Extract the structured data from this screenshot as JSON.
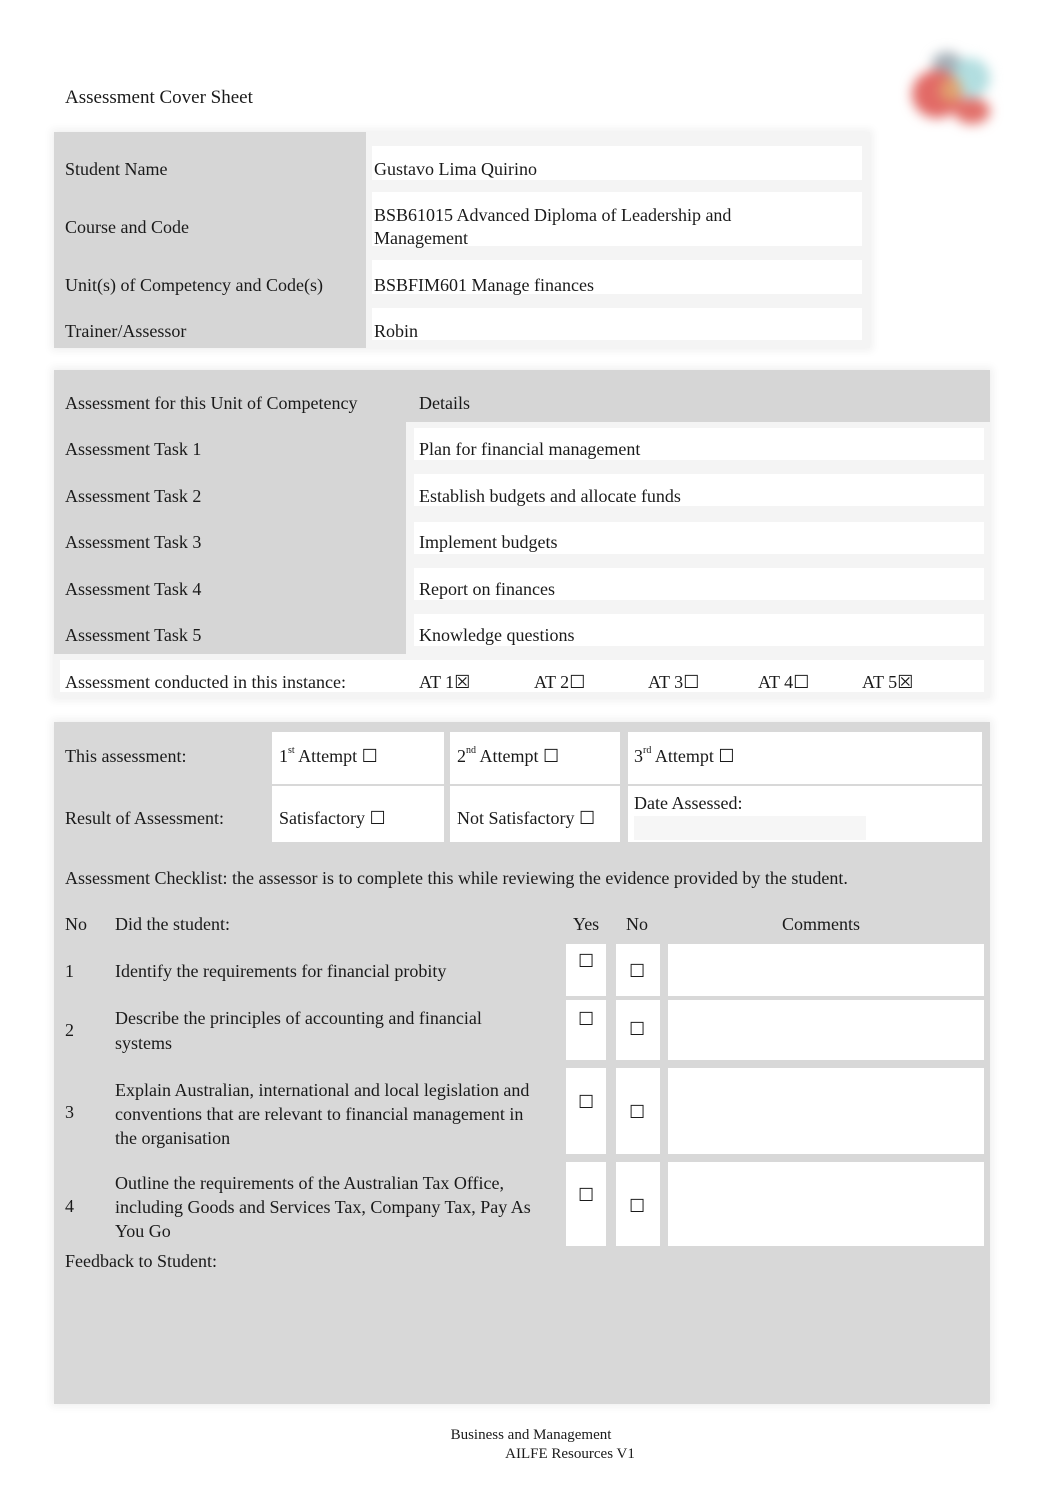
{
  "header": {
    "title": "Assessment Cover Sheet",
    "logo": "institution-logo"
  },
  "details": [
    {
      "label": "Student Name",
      "value": "Gustavo Lima Quirino"
    },
    {
      "label": "Course and Code",
      "value": "BSB61015 Advanced Diploma of Leadership and Management"
    },
    {
      "label": "Unit(s) of Competency and Code(s)",
      "value": "BSBFIM601 Manage finances"
    },
    {
      "label": "Trainer/Assessor",
      "value": "Robin"
    }
  ],
  "tasks": {
    "header_left": "Assessment for this Unit of Competency",
    "header_right": "Details",
    "rows": [
      {
        "label": "Assessment Task 1",
        "value": "Plan for financial management"
      },
      {
        "label": "Assessment Task 2",
        "value": "Establish budgets and allocate funds"
      },
      {
        "label": "Assessment Task 3",
        "value": "Implement budgets"
      },
      {
        "label": "Assessment Task 4",
        "value": "Report on finances"
      },
      {
        "label": "Assessment Task 5",
        "value": "Knowledge questions"
      }
    ],
    "instance_label": "Assessment conducted in this instance:",
    "instances": [
      {
        "label": "AT 1",
        "box": "☒",
        "checked": true
      },
      {
        "label": "AT 2",
        "box": "☐",
        "checked": false
      },
      {
        "label": "AT 3",
        "box": "☐",
        "checked": false
      },
      {
        "label": "AT 4",
        "box": "☐",
        "checked": false
      },
      {
        "label": "AT 5",
        "box": "☒",
        "checked": true
      }
    ]
  },
  "attempt": {
    "label": "This assessment:",
    "options": [
      {
        "num": "1",
        "sup": "st",
        "text": " Attempt ",
        "box": "☐",
        "checked": false
      },
      {
        "num": "2",
        "sup": "nd",
        "text": " Attempt ",
        "box": "☐",
        "checked": false
      },
      {
        "num": "3",
        "sup": "rd",
        "text": " Attempt ",
        "box": "☐",
        "checked": false
      }
    ]
  },
  "result": {
    "label": "Result of Assessment:",
    "satisfactory": {
      "text": "Satisfactory ",
      "box": "☐",
      "checked": false
    },
    "not_satisfactory": {
      "text": "Not Satisfactory ",
      "box": "☐",
      "checked": false
    },
    "date_label": "Date Assessed:",
    "date_value": ""
  },
  "checklist": {
    "intro": "Assessment Checklist: the assessor is to complete this while reviewing the evidence provided by the student.",
    "headers": {
      "no": "No",
      "did": "Did the student:",
      "yes": "Yes",
      "no2": "No",
      "comments": "Comments"
    },
    "rows": [
      {
        "no": "1",
        "text": "Identify the requirements for financial probity",
        "yes": "☐",
        "no_box": "☐",
        "comment": ""
      },
      {
        "no": "2",
        "text": "Describe the principles of accounting and financial systems",
        "yes": "☐",
        "no_box": "☐",
        "comment": ""
      },
      {
        "no": "3",
        "text": "Explain Australian, international and local legislation and conventions that are relevant to financial management in the organisation",
        "yes": "☐",
        "no_box": "☐",
        "comment": ""
      },
      {
        "no": "4",
        "text": "Outline the requirements of the Australian Tax Office, including Goods and Services Tax, Company Tax, Pay As You Go",
        "yes": "☐",
        "no_box": "☐",
        "comment": ""
      }
    ],
    "feedback_label": "Feedback to Student:",
    "feedback_value": ""
  },
  "footer": {
    "line1": "Business and Management",
    "line2": "AILFE Resources V1"
  }
}
